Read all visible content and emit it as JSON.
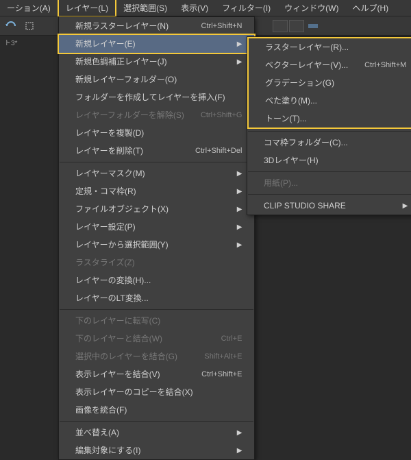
{
  "menubar": {
    "items": [
      {
        "label": "ーション(A)"
      },
      {
        "label": "レイヤー(L)",
        "active": true
      },
      {
        "label": "選択範囲(S)"
      },
      {
        "label": "表示(V)"
      },
      {
        "label": "フィルター(I)"
      },
      {
        "label": "ウィンドウ(W)"
      },
      {
        "label": "ヘルプ(H)"
      }
    ]
  },
  "status": "ト3*",
  "layerMenu": {
    "groups": [
      [
        {
          "label": "新規ラスターレイヤー(N)",
          "shortcut": "Ctrl+Shift+N"
        },
        {
          "label": "新規レイヤー(E)",
          "submenu": true,
          "highlight": true,
          "hover": true
        },
        {
          "label": "新規色調補正レイヤー(J)",
          "submenu": true
        },
        {
          "label": "新規レイヤーフォルダー(O)"
        },
        {
          "label": "フォルダーを作成してレイヤーを挿入(F)"
        },
        {
          "label": "レイヤーフォルダーを解除(S)",
          "shortcut": "Ctrl+Shift+G",
          "disabled": true
        },
        {
          "label": "レイヤーを複製(D)"
        },
        {
          "label": "レイヤーを削除(T)",
          "shortcut": "Ctrl+Shift+Del"
        }
      ],
      [
        {
          "label": "レイヤーマスク(M)",
          "submenu": true
        },
        {
          "label": "定規・コマ枠(R)",
          "submenu": true
        },
        {
          "label": "ファイルオブジェクト(X)",
          "submenu": true
        },
        {
          "label": "レイヤー設定(P)",
          "submenu": true
        },
        {
          "label": "レイヤーから選択範囲(Y)",
          "submenu": true
        },
        {
          "label": "ラスタライズ(Z)",
          "disabled": true
        },
        {
          "label": "レイヤーの変換(H)..."
        },
        {
          "label": "レイヤーのLT変換..."
        }
      ],
      [
        {
          "label": "下のレイヤーに転写(C)",
          "disabled": true
        },
        {
          "label": "下のレイヤーと結合(W)",
          "shortcut": "Ctrl+E",
          "disabled": true
        },
        {
          "label": "選択中のレイヤーを結合(G)",
          "shortcut": "Shift+Alt+E",
          "disabled": true
        },
        {
          "label": "表示レイヤーを結合(V)",
          "shortcut": "Ctrl+Shift+E"
        },
        {
          "label": "表示レイヤーのコピーを結合(X)"
        },
        {
          "label": "画像を統合(F)"
        }
      ],
      [
        {
          "label": "並べ替え(A)",
          "submenu": true
        },
        {
          "label": "編集対象にする(I)",
          "submenu": true
        }
      ]
    ]
  },
  "subMenu": {
    "groups": [
      [
        {
          "label": "ラスターレイヤー(R)...",
          "box": true
        },
        {
          "label": "ベクターレイヤー(V)...",
          "shortcut": "Ctrl+Shift+M",
          "box": true
        },
        {
          "label": "グラデーション(G)",
          "box": true
        },
        {
          "label": "べた塗り(M)...",
          "box": true
        },
        {
          "label": "トーン(T)...",
          "box": true
        }
      ],
      [
        {
          "label": "コマ枠フォルダー(C)..."
        },
        {
          "label": "3Dレイヤー(H)"
        }
      ],
      [
        {
          "label": "用紙(P)...",
          "disabled": true
        }
      ],
      [
        {
          "label": "CLIP STUDIO SHARE",
          "submenu": true
        }
      ]
    ]
  }
}
